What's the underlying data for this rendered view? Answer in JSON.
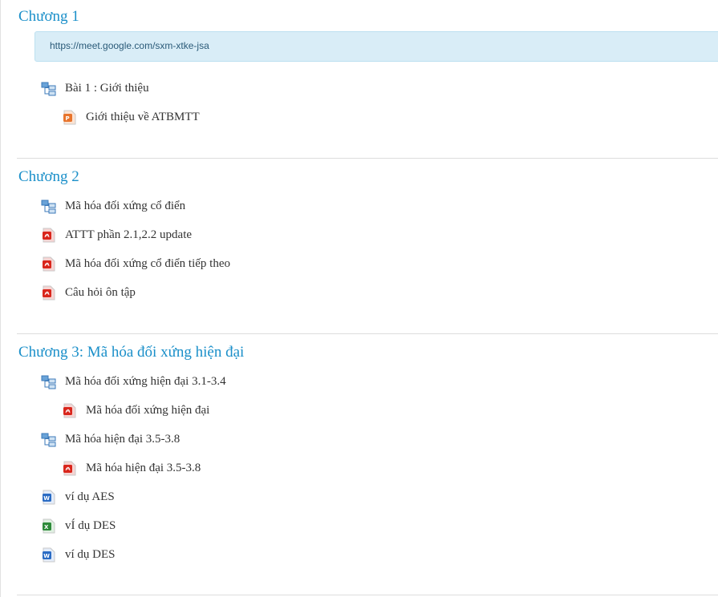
{
  "sections": [
    {
      "title": "Chương 1",
      "url_box": "https://meet.google.com/sxm-xtke-jsa",
      "items": [
        {
          "label": "Bài 1 : Giới thiệu",
          "icon": "folder-icon"
        },
        {
          "label": "Giới thiệu về ATBMTT",
          "icon": "powerpoint-file-icon"
        }
      ]
    },
    {
      "title": "Chương 2",
      "items": [
        {
          "label": "Mã hóa đối xứng cổ điển",
          "icon": "folder-icon"
        },
        {
          "label": "ATTT phần 2.1,2.2 update",
          "icon": "pdf-file-icon"
        },
        {
          "label": "Mã hóa đối xứng cổ điển tiếp theo",
          "icon": "pdf-file-icon"
        },
        {
          "label": "Câu hỏi ôn tập",
          "icon": "pdf-file-icon"
        }
      ]
    },
    {
      "title": "Chương 3: Mã hóa đối xứng hiện đại",
      "items": [
        {
          "label": "Mã hóa đối xứng hiện đại 3.1-3.4",
          "icon": "folder-icon"
        },
        {
          "label": "Mã hóa đối xứng hiện đại",
          "icon": "pdf-file-icon"
        },
        {
          "label": "Mã hóa hiện đại 3.5-3.8",
          "icon": "folder-icon"
        },
        {
          "label": "Mã hóa hiện đại 3.5-3.8",
          "icon": "pdf-file-icon"
        },
        {
          "label": "ví dụ AES",
          "icon": "word-file-icon"
        },
        {
          "label": "vÍ dụ DES",
          "icon": "excel-file-icon"
        },
        {
          "label": "ví dụ DES",
          "icon": "word-file-icon"
        }
      ]
    }
  ],
  "colors": {
    "section_title": "#1a8fc9",
    "url_box_bg": "#d9edf7",
    "pdf": "#d9261c",
    "folder": "#4a8ed0",
    "word": "#2b6cc4",
    "excel": "#2e8b3a",
    "powerpoint": "#e8742c"
  }
}
